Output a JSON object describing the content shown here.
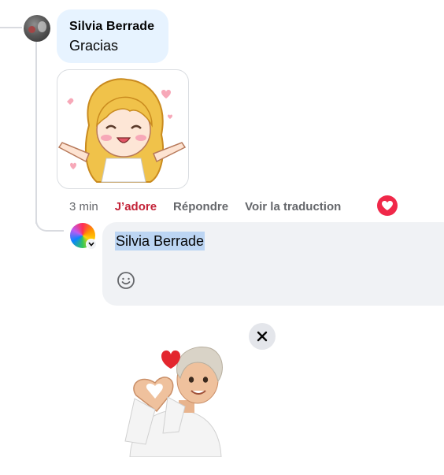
{
  "comment": {
    "author": "Silvia Berrade",
    "text": "Gracias",
    "sticker_icon": "blonde-girl-cheering-sticker-icon",
    "actions": {
      "timestamp": "3 min",
      "like": "J’adore",
      "reply": "Répondre",
      "translate": "Voir la traduction"
    },
    "reaction_icon": "love-reaction-icon"
  },
  "reply": {
    "mention": "Silvia Berrade",
    "emoji_icon": "emoji-smile-icon",
    "attachment_icon": "avatar-heart-hands-sticker-icon",
    "close_icon": "close-icon"
  },
  "colors": {
    "bubble": "#e7f3ff",
    "composer": "#f0f2f5",
    "like_red": "#c32338",
    "reaction_red": "#f02849",
    "mention_highlight": "#bcd5f3"
  }
}
